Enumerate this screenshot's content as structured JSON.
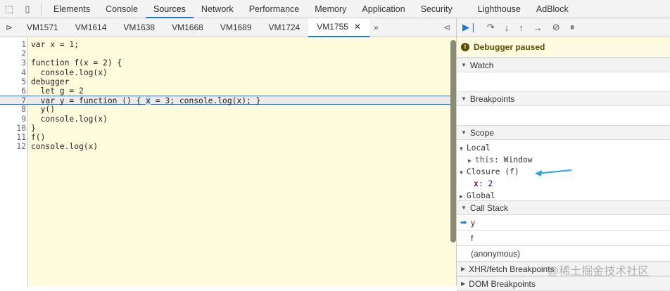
{
  "main_tabs": [
    "Elements",
    "Console",
    "Sources",
    "Network",
    "Performance",
    "Memory",
    "Application",
    "Security",
    "Lighthouse",
    "AdBlock"
  ],
  "active_main_tab": "Sources",
  "file_tabs": [
    "VM1571",
    "VM1614",
    "VM1638",
    "VM1668",
    "VM1689",
    "VM1724",
    "VM1755"
  ],
  "active_file_tab": "VM1755",
  "more_tabs": "»",
  "code_lines": [
    "var x = 1;",
    "",
    "function f(x = 2) {",
    "  console.log(x)",
    "debugger",
    "  let g = 2",
    "  var y = function () { x = 3; console.log(x); }",
    "  y()",
    "  console.log(x)",
    "}",
    "f()",
    "console.log(x)"
  ],
  "current_line": 7,
  "debugger_status": "Debugger paused",
  "sections": {
    "watch": "Watch",
    "breakpoints": "Breakpoints",
    "scope": "Scope",
    "call_stack": "Call Stack",
    "xhr": "XHR/fetch Breakpoints",
    "dom": "DOM Breakpoints"
  },
  "scope": {
    "local": "Local",
    "this_key": "this",
    "this_val": "Window",
    "closure": "Closure (f)",
    "x_key": "x",
    "x_val": "2",
    "global": "Global"
  },
  "call_stack": [
    "y",
    "f",
    "(anonymous)"
  ],
  "watermark": "@稀土掘金技术社区"
}
